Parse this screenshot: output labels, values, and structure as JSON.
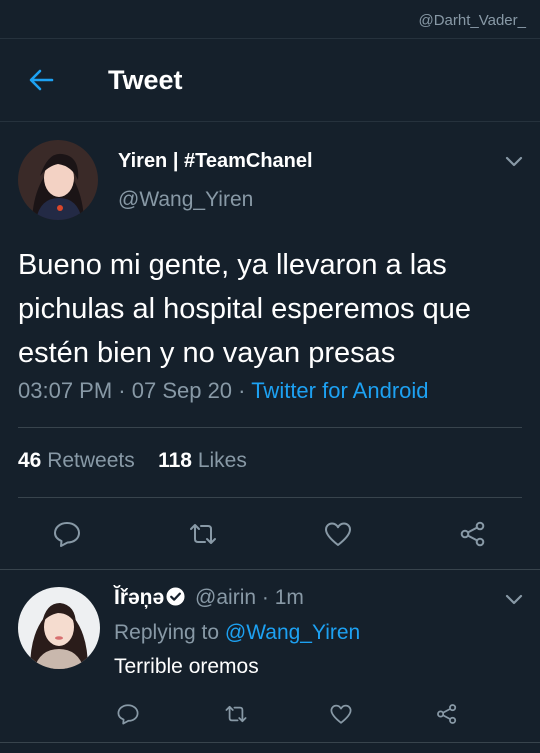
{
  "watermark": "@Darht_Vader_",
  "header": {
    "title": "Tweet"
  },
  "tweet": {
    "author_name": "Yiren | #TeamChanel",
    "author_handle": "@Wang_Yiren",
    "text": "Bueno mi gente, ya llevaron a las pichulas al hospital esperemos que estén bien y no vayan presas",
    "time": "03:07 PM",
    "date": "07 Sep 20",
    "source": "Twitter for Android",
    "retweets_count": "46",
    "retweets_label": "Retweets",
    "likes_count": "118",
    "likes_label": "Likes"
  },
  "reply": {
    "author_name": "Ĭřəņə",
    "author_handle": "@airin",
    "time_ago": "1m",
    "replying_to_label": "Replying to",
    "replying_to_handle": "@Wang_Yiren",
    "text": "Terrible oremos"
  },
  "icons": {
    "back": "arrow-left",
    "more": "chevron-down",
    "reply": "speech-bubble",
    "retweet": "retweet-arrows",
    "like": "heart",
    "share": "share-nodes",
    "verified": "verified-badge"
  },
  "colors": {
    "background": "#15202b",
    "accent": "#1da1f2",
    "muted": "#8899a6",
    "divider": "#38444d"
  }
}
